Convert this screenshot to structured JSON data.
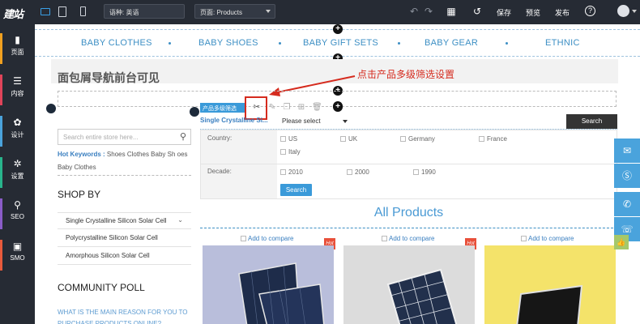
{
  "topbar": {
    "logo": "建站",
    "language_select": "语种: 英语",
    "page_select": "页面: Products",
    "save": "保存",
    "preview": "预览",
    "publish": "发布",
    "help_icon": "?",
    "device_icons": [
      "desktop-icon",
      "tablet-icon",
      "mobile-icon"
    ]
  },
  "sidebar": {
    "items": [
      {
        "label": "页面",
        "icon": "page-icon",
        "color": "#f0a020"
      },
      {
        "label": "内容",
        "icon": "content-icon",
        "color": "#e0445a"
      },
      {
        "label": "设计",
        "icon": "palette-icon",
        "color": "#4aa3dc"
      },
      {
        "label": "设置",
        "icon": "gear-icon",
        "color": "#28b48c"
      },
      {
        "label": "SEO",
        "icon": "search-icon",
        "color": "#8a5cc8"
      },
      {
        "label": "SMO",
        "icon": "briefcase-icon",
        "color": "#e85a3c"
      }
    ]
  },
  "nav": {
    "items": [
      "BABY CLOTHES",
      "BABY SHOES",
      "BABY GIFT SETS",
      "BABY GEAR",
      "ETHNIC"
    ]
  },
  "breadcrumb_note": "面包屑导航前台可见",
  "annotation": "点击产品多级筛选设置",
  "left": {
    "search_placeholder": "Search entire store here...",
    "hot_keywords_label": "Hot Keywords :",
    "hot_keywords_text": "Shoes  Clothes  Baby Sh oes  Baby Clothes",
    "shop_by": "SHOP BY",
    "categories": [
      "Single Crystalline Silicon Solar Cell",
      "Polycrystalline Silicon Solar Cell",
      "Amorphous Silicon Solar Cell"
    ],
    "poll_title": "COMMUNITY POLL",
    "poll_question": "WHAT IS THE MAIN REASON FOR YOU TO PURCHASE PRODUCTS ONLINE?"
  },
  "filter": {
    "tag": "产品多级筛选",
    "title": "Single Crystalline Si...",
    "dropdown": "Please select",
    "search_button": "Search",
    "country_label": "Country:",
    "countries": [
      "US",
      "UK",
      "Germany",
      "France",
      "Italy"
    ],
    "decade_label": "Decade:",
    "decades": [
      "2010",
      "2000",
      "1990"
    ],
    "apply_button": "Search"
  },
  "products": {
    "heading": "All Products",
    "items": [
      {
        "compare": "Add to compare",
        "badge": "Hot",
        "bg": "#b9bedb"
      },
      {
        "compare": "Add to compare",
        "badge": "Hot",
        "bg": "#dcdcdc"
      },
      {
        "compare": "Add to compare",
        "badge": "Hot",
        "bg": "#f4e36a"
      }
    ]
  },
  "contact": {
    "buttons": [
      "mail-icon",
      "skype-icon",
      "phone-icon",
      "whatsapp-icon"
    ]
  }
}
